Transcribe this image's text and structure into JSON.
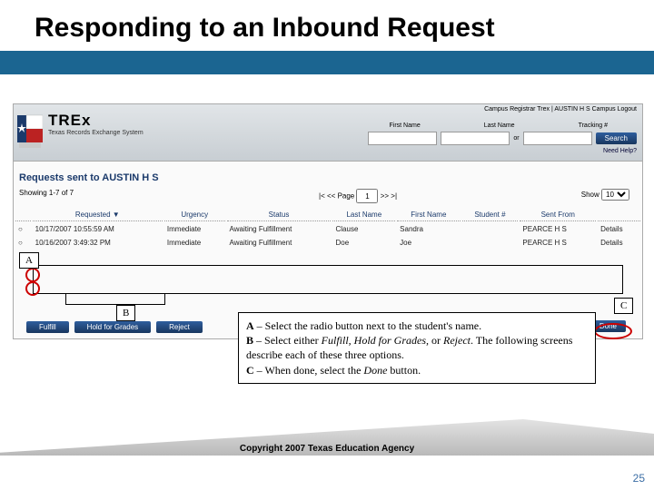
{
  "slide": {
    "title": "Responding to an Inbound Request",
    "copyright": "Copyright 2007 Texas Education Agency",
    "page_number": "25"
  },
  "labels": {
    "A": "A",
    "B": "B",
    "C": "C"
  },
  "instructions": {
    "line_a_prefix": "A",
    "line_a_text": " – Select the radio button next to the student's name.",
    "line_b_prefix": "B",
    "line_b_text_1": " – Select either ",
    "line_b_em1": "Fulfill, Hold for Grades,",
    "line_b_text_2": " or ",
    "line_b_em2": "Reject",
    "line_b_text_3": ". The following screens describe each of these three options.",
    "line_c_prefix": "C",
    "line_c_text_1": " – When done, select the ",
    "line_c_em": "Done",
    "line_c_text_2": " button."
  },
  "app": {
    "logo_text": "TREx",
    "logo_sub": "Texas Records Exchange System",
    "registrar_text": "Campus Registrar Trex | AUSTIN H S Campus   Logout",
    "search_labels": {
      "first": "First Name",
      "last": "Last Name",
      "tracking": "Tracking #"
    },
    "or": "or",
    "search_btn": "Search",
    "need_help": "Need Help?",
    "section_title": "Requests sent to AUSTIN H S",
    "showing": "Showing 1-7 of 7",
    "pager": {
      "prev": "|< <<",
      "label": "Page",
      "value": "1",
      "next": ">> >|"
    },
    "show_label": "Show",
    "show_value": "10",
    "table": {
      "headers": [
        "",
        "Requested ▼",
        "Urgency",
        "Status",
        "Last Name",
        "First Name",
        "Student #",
        "Sent From",
        ""
      ],
      "rows": [
        [
          "○",
          "10/17/2007 10:55:59 AM",
          "Immediate",
          "Awaiting Fulfillment",
          "Clause",
          "Sandra",
          "",
          "PEARCE H S",
          "Details"
        ],
        [
          "○",
          "10/16/2007 3:49:32 PM",
          "Immediate",
          "Awaiting Fulfillment",
          "Doe",
          "Joe",
          "",
          "PEARCE H S",
          "Details"
        ]
      ]
    },
    "actions": {
      "fulfill": "Fulfill",
      "hold": "Hold for Grades",
      "reject": "Reject",
      "done": "Done"
    }
  }
}
